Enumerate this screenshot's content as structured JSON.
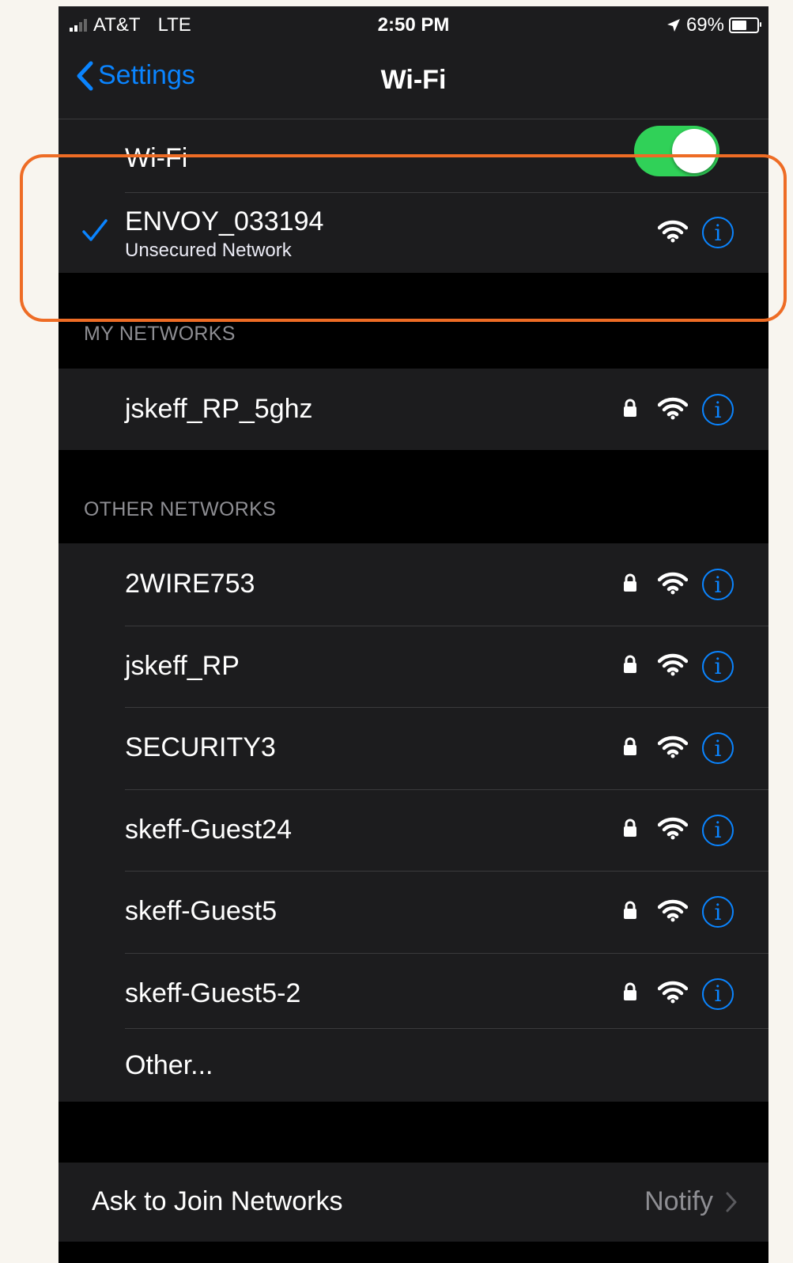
{
  "status_bar": {
    "carrier": "AT&T",
    "network": "LTE",
    "time": "2:50 PM",
    "battery_percent": "69%",
    "battery_level": 0.69
  },
  "nav": {
    "back_label": "Settings",
    "title": "Wi-Fi"
  },
  "wifi_toggle": {
    "label": "Wi-Fi",
    "on": true
  },
  "connected_network": {
    "name": "ENVOY_033194",
    "subtitle": "Unsecured Network"
  },
  "my_networks": {
    "header": "MY NETWORKS",
    "items": [
      {
        "name": "jskeff_RP_5ghz",
        "locked": true
      }
    ]
  },
  "other_networks": {
    "header": "OTHER NETWORKS",
    "items": [
      {
        "name": "2WIRE753",
        "locked": true
      },
      {
        "name": "jskeff_RP",
        "locked": true
      },
      {
        "name": "SECURITY3",
        "locked": true
      },
      {
        "name": "skeff-Guest24",
        "locked": true
      },
      {
        "name": "skeff-Guest5",
        "locked": true
      },
      {
        "name": "skeff-Guest5-2",
        "locked": true
      }
    ],
    "other_label": "Other..."
  },
  "ask_to_join": {
    "label": "Ask to Join Networks",
    "value": "Notify"
  },
  "colors": {
    "accent": "#0a84ff",
    "toggle_on": "#30d158",
    "highlight": "#ee6c25"
  },
  "icons": {
    "lock": "lock-icon",
    "wifi": "wifi-icon",
    "info": "info-icon",
    "check": "checkmark-icon",
    "back": "chevron-left-icon",
    "disclosure": "chevron-right-icon"
  }
}
